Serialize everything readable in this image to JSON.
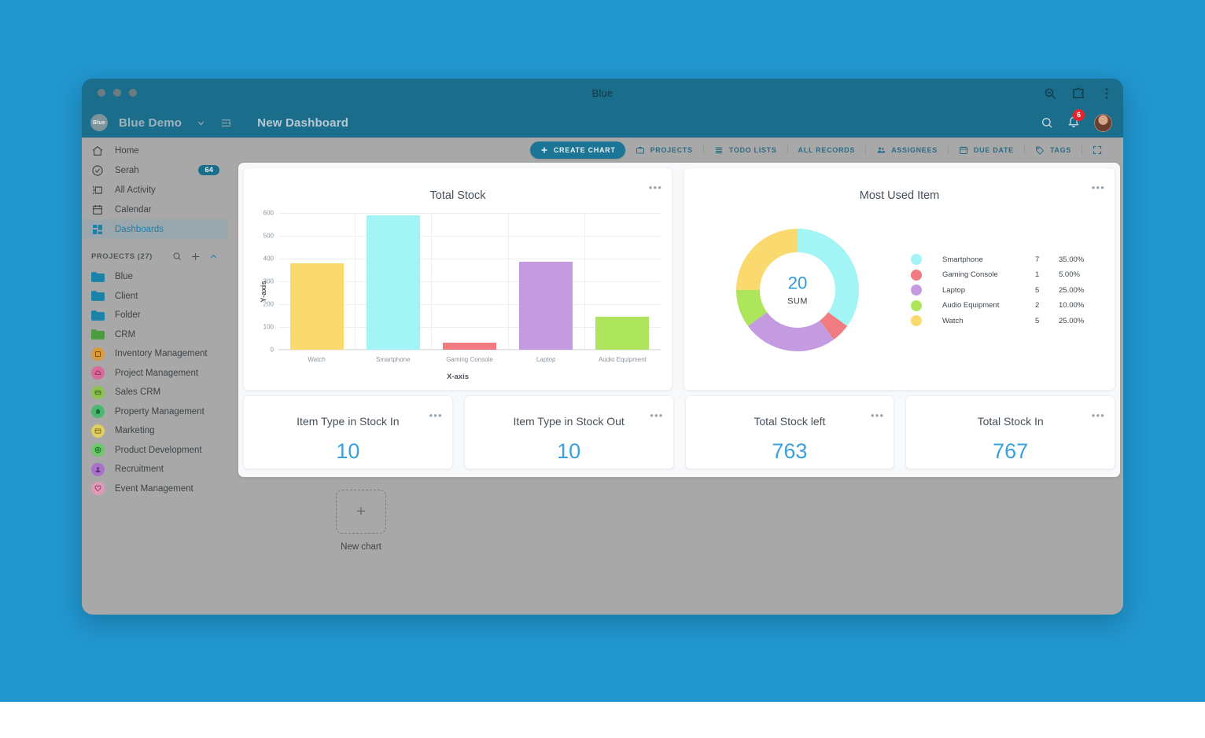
{
  "browser": {
    "tab_title": "Blue",
    "icons": [
      "zoom-out-icon",
      "extensions-icon",
      "browser-menu-icon"
    ]
  },
  "header": {
    "logo_text": "Blue",
    "workspace": "Blue Demo",
    "dashboard_title": "New Dashboard",
    "notification_count": "6",
    "icons": [
      "chevron-down-icon",
      "collapse-sidebar-icon",
      "search-icon",
      "bell-icon",
      "avatar"
    ]
  },
  "sidebar": {
    "nav": [
      {
        "label": "Home",
        "icon": "home-icon",
        "count": "",
        "active": false
      },
      {
        "label": "Serah",
        "icon": "check-circle-icon",
        "count": "64",
        "active": false
      },
      {
        "label": "All Activity",
        "icon": "activity-icon",
        "count": "",
        "active": false
      },
      {
        "label": "Calendar",
        "icon": "calendar-icon",
        "count": "",
        "active": false
      },
      {
        "label": "Dashboards",
        "icon": "dashboard-grid-icon",
        "count": "",
        "active": true
      }
    ],
    "projects_header": "PROJECTS (27)",
    "projects_actions": [
      "search-icon",
      "plus-icon",
      "chevron-up-icon"
    ],
    "projects": [
      {
        "label": "Blue",
        "type": "folder",
        "color": "#1b83a8"
      },
      {
        "label": "Client",
        "type": "folder",
        "color": "#1b83a8"
      },
      {
        "label": "Folder",
        "type": "folder",
        "color": "#1b83a8"
      },
      {
        "label": "CRM",
        "type": "folder",
        "color": "#4a9e3f"
      },
      {
        "label": "Inventory Management",
        "type": "dot",
        "color": "#d99a3e",
        "glyph": "box-icon"
      },
      {
        "label": "Project Management",
        "type": "dot",
        "color": "#d96a9c",
        "glyph": "cloud-icon"
      },
      {
        "label": "Sales CRM",
        "type": "dot",
        "color": "#8dc152",
        "glyph": "card-icon"
      },
      {
        "label": "Property Management",
        "type": "dot",
        "color": "#4bb86f",
        "glyph": "home-icon"
      },
      {
        "label": "Marketing",
        "type": "dot",
        "color": "#e0cf62",
        "glyph": "window-icon"
      },
      {
        "label": "Product Development",
        "type": "dot",
        "color": "#6bc96b",
        "glyph": "gear-icon"
      },
      {
        "label": "Recruitment",
        "type": "dot",
        "color": "#a972c9",
        "glyph": "user-icon"
      },
      {
        "label": "Event Management",
        "type": "dot",
        "color": "#e09ab8",
        "glyph": "heart-icon"
      }
    ]
  },
  "toolbar": {
    "create_chart": "CREATE CHART",
    "items": [
      {
        "label": "PROJECTS",
        "icon": "briefcase-icon"
      },
      {
        "label": "TODO LISTS",
        "icon": "list-icon"
      },
      {
        "label": "ALL RECORDS",
        "icon": ""
      },
      {
        "label": "ASSIGNEES",
        "icon": "people-icon"
      },
      {
        "label": "DUE DATE",
        "icon": "calendar-icon"
      },
      {
        "label": "TAGS",
        "icon": "tag-icon"
      }
    ],
    "fullscreen_icon": "fullscreen-icon"
  },
  "kpis": [
    {
      "title": "Item Type in Stock In",
      "value": "10"
    },
    {
      "title": "Item Type in Stock Out",
      "value": "10"
    },
    {
      "title": "Total Stock left",
      "value": "763"
    },
    {
      "title": "Total Stock In",
      "value": "767"
    }
  ],
  "new_chart": {
    "label": "New chart",
    "icon": "plus-icon"
  },
  "chart_data": [
    {
      "type": "bar",
      "title": "Total Stock",
      "xlabel": "X-axis",
      "ylabel": "Y-axis",
      "categories": [
        "Watch",
        "Smartphone",
        "Gaming Console",
        "Laptop",
        "Audio Equipment"
      ],
      "values": [
        380,
        588,
        30,
        386,
        146
      ],
      "colors": [
        "#FAD96E",
        "#A3F5F5",
        "#F07C82",
        "#C49BE0",
        "#ADE55C"
      ],
      "ylim": [
        0,
        600
      ],
      "yticks": [
        0,
        100,
        200,
        300,
        400,
        500,
        600
      ],
      "grid": true,
      "legend": "none"
    },
    {
      "type": "pie",
      "title": "Most Used Item",
      "center_value": "20",
      "center_label": "SUM",
      "legend_position": "right",
      "categories": [
        "Smartphone",
        "Gaming Console",
        "Laptop",
        "Audio Equipment",
        "Watch"
      ],
      "values": [
        7,
        1,
        5,
        2,
        5
      ],
      "percents": [
        "35.00%",
        "5.00%",
        "25.00%",
        "10.00%",
        "25.00%"
      ],
      "colors": [
        "#A3F5F5",
        "#F07C82",
        "#C49BE0",
        "#ADE55C",
        "#FAD96E"
      ],
      "total": 20
    }
  ],
  "colors": {
    "brand": "#1b6d8c",
    "accent": "#3aa0dc",
    "wallpaper": "#2196cf",
    "badge": "#e8232a"
  }
}
